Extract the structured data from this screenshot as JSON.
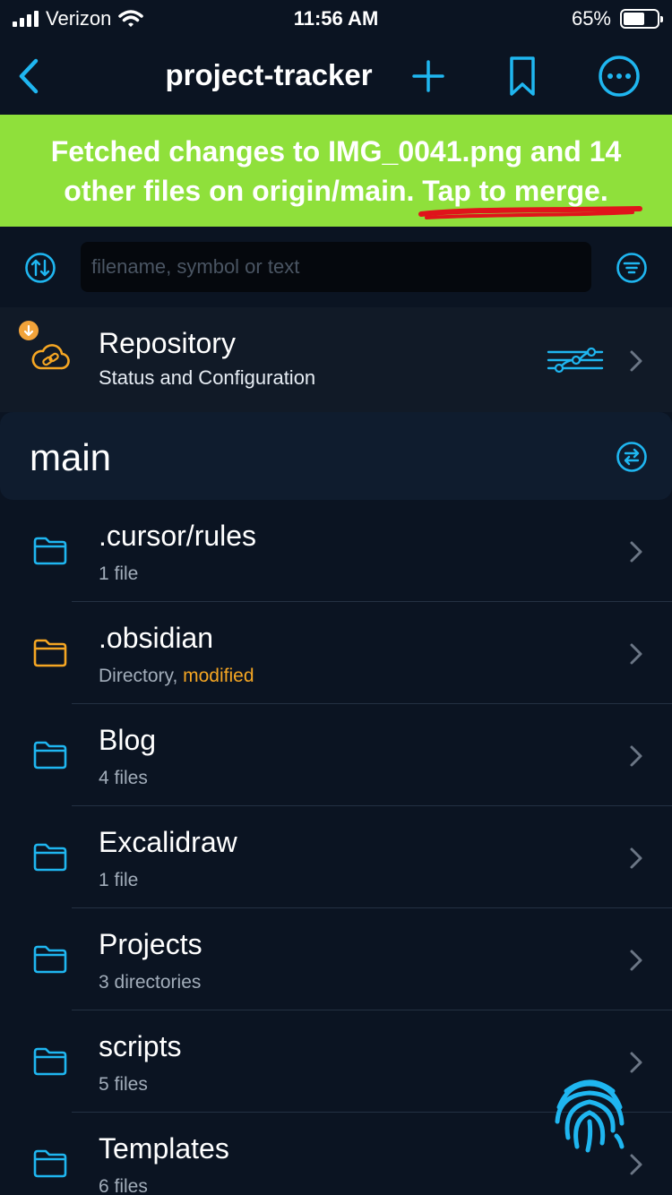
{
  "status_bar": {
    "carrier": "Verizon",
    "time": "11:56 AM",
    "battery": "65%",
    "battery_level": 0.65
  },
  "nav": {
    "title": "project-tracker",
    "back_icon": "chevron-left-icon",
    "add_icon": "plus-icon",
    "bookmark_icon": "bookmark-icon",
    "more_icon": "ellipsis-circle-icon"
  },
  "banner": {
    "text": "Fetched changes to IMG_0041.png and 14 other files on origin/main.",
    "link": "Tap to merge.",
    "color": "#8fe03b"
  },
  "search": {
    "placeholder": "filename, symbol or text",
    "value": ""
  },
  "repository": {
    "title": "Repository",
    "subtitle": "Status and Configuration"
  },
  "branch": {
    "name": "main"
  },
  "files": [
    {
      "name": ".cursor/rules",
      "detail": "1 file",
      "modified": "",
      "folder_color": "#1fb6f0"
    },
    {
      "name": ".obsidian",
      "detail": "Directory, ",
      "modified": "modified",
      "folder_color": "#f5a623"
    },
    {
      "name": "Blog",
      "detail": "4 files",
      "modified": "",
      "folder_color": "#1fb6f0"
    },
    {
      "name": "Excalidraw",
      "detail": "1 file",
      "modified": "",
      "folder_color": "#1fb6f0"
    },
    {
      "name": "Projects",
      "detail": "3 directories",
      "modified": "",
      "folder_color": "#1fb6f0"
    },
    {
      "name": "scripts",
      "detail": "5 files",
      "modified": "",
      "folder_color": "#1fb6f0"
    },
    {
      "name": "Templates",
      "detail": "6 files",
      "modified": "",
      "folder_color": "#1fb6f0"
    }
  ],
  "colors": {
    "accent": "#1fb6f0",
    "modified": "#f5a623",
    "background": "#0b1422"
  }
}
